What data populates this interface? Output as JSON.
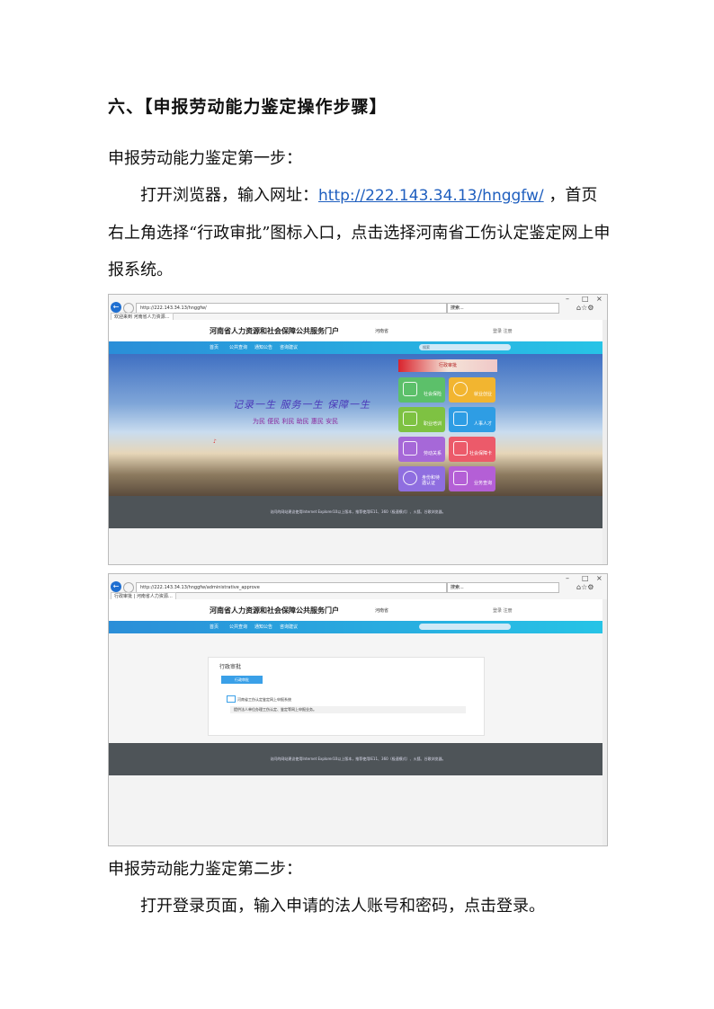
{
  "heading": "六、【申报劳动能力鉴定操作步骤】",
  "step1": {
    "title": "申报劳动能力鉴定第一步：",
    "before": "打开浏览器，输入网址：",
    "url": "http://222.143.34.13/hnggfw/",
    "after": " ，首页右上角选择“行政审批”图标入口，点击选择河南省工伤认定鉴定网上申报系统。"
  },
  "shot1": {
    "address": "http://222.143.34.13/hnggfw/",
    "tab": "欢迎来到 河南省人力资源…",
    "search_placeholder": "搜索...",
    "portal_title": "河南省人力资源和社会保障公共服务门户",
    "region": "河南省",
    "login": "登录  注册",
    "nav": [
      "首页",
      "公共查询",
      "通知公告",
      "咨询建议"
    ],
    "nav_search": "搜索",
    "slogan": "记录一生  服务一生  保障一生",
    "slogan_sub": "为民  便民  利民  助民  惠民  安民",
    "approval": "行政审批",
    "tiles": [
      "社会保险",
      "就业创业",
      "职业培训",
      "人事人才",
      "劳动关系",
      "社会保障卡",
      "身份和待遇认证",
      "业务查询"
    ],
    "footer": "访问的网站建议使用Internet Explorer10以上版本，推荐使用IE11、360（极速模式）、火狐、谷歌浏览器。"
  },
  "shot2": {
    "address": "http://222.143.34.13/hnggfw/administrative_approve",
    "tab": "行政审批 | 河南省人力资源…",
    "search_placeholder": "搜索...",
    "portal_title": "河南省人力资源和社会保障公共服务门户",
    "region": "河南省",
    "login": "登录  注册",
    "nav": [
      "首页",
      "公共查询",
      "通知公告",
      "咨询建议"
    ],
    "panel_title": "行政审批",
    "panel_tab": "行政审批",
    "item": "河南省工伤认定鉴定网上申报系统",
    "item_desc": "提供法人单位办理工伤认定、鉴定等网上申报业务。",
    "footer": "访问的网站建议使用Internet Explorer10以上版本，推荐使用IE11、360（极速模式）、火狐、谷歌浏览器。"
  },
  "step2": {
    "title": "申报劳动能力鉴定第二步：",
    "text": "打开登录页面，输入申请的法人账号和密码，点击登录。"
  }
}
